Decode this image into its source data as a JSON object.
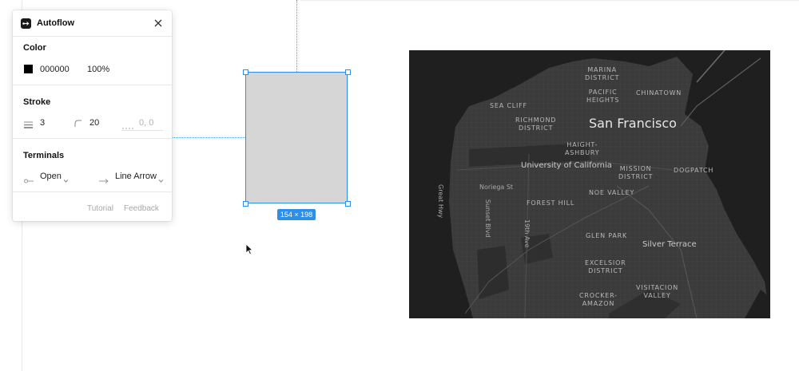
{
  "panel": {
    "title": "Autoflow",
    "color": {
      "heading": "Color",
      "hex": "000000",
      "opacity": "100%",
      "swatch_color": "#000000"
    },
    "stroke": {
      "heading": "Stroke",
      "weight": "3",
      "radius": "20",
      "dash_placeholder": "0, 0"
    },
    "terminals": {
      "heading": "Terminals",
      "start": "Open",
      "end": "Line Arrow"
    },
    "footer": {
      "tutorial": "Tutorial",
      "feedback": "Feedback"
    }
  },
  "canvas": {
    "selection_size": "154 × 198",
    "selection_color": "#2d8fe8"
  },
  "map": {
    "labels": {
      "san_francisco": "San Francisco",
      "marina_1": "MARINA",
      "marina_2": "DISTRICT",
      "pacific_1": "PACIFIC",
      "pacific_2": "HEIGHTS",
      "chinatown": "CHINATOWN",
      "sea_cliff": "SEA CLIFF",
      "richmond_1": "RICHMOND",
      "richmond_2": "DISTRICT",
      "haight_1": "HAIGHT-",
      "haight_2": "ASHBURY",
      "univ": "University of California",
      "mission_1": "MISSION",
      "mission_2": "DISTRICT",
      "dogpatch": "DOGPATCH",
      "great_hwy": "Great Hwy",
      "noriega": "Noriega St",
      "sunset": "Sunset Blvd",
      "noe": "NOE VALLEY",
      "forest": "FOREST HILL",
      "ave19": "19th Ave",
      "glen": "GLEN PARK",
      "silver": "Silver Terrace",
      "excelsior_1": "EXCELSIOR",
      "excelsior_2": "DISTRICT",
      "visitacion_1": "VISITACION",
      "visitacion_2": "VALLEY",
      "crocker_1": "CROCKER-",
      "crocker_2": "AMAZON"
    }
  }
}
